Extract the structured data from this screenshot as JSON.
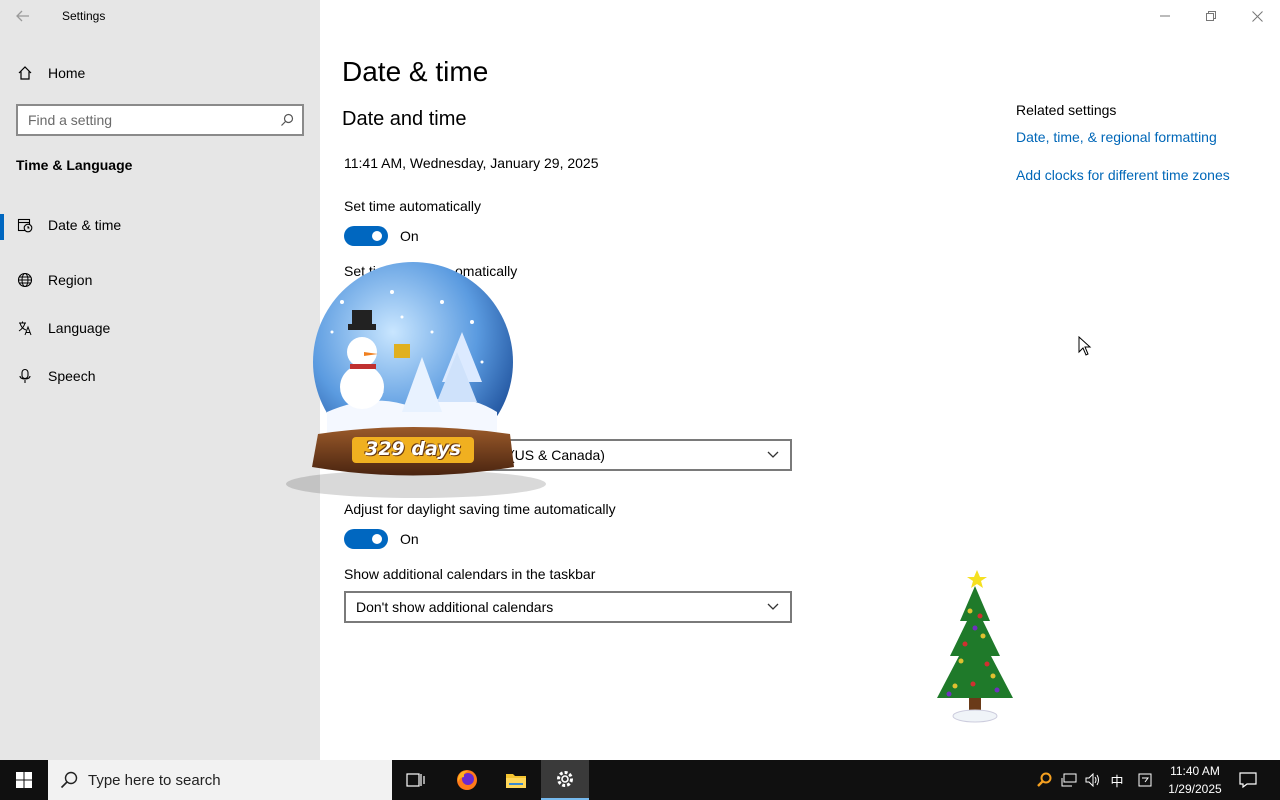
{
  "window": {
    "app_title": "Settings"
  },
  "sidebar": {
    "home_label": "Home",
    "search_placeholder": "Find a setting",
    "section_title": "Time & Language",
    "items": [
      {
        "label": "Date & time",
        "icon": "date-time-icon",
        "active": true
      },
      {
        "label": "Region",
        "icon": "globe-icon",
        "active": false
      },
      {
        "label": "Language",
        "icon": "language-icon",
        "active": false
      },
      {
        "label": "Speech",
        "icon": "microphone-icon",
        "active": false
      }
    ]
  },
  "main": {
    "page_title": "Date & time",
    "sub_title": "Date and time",
    "current_time": "11:41 AM, Wednesday, January 29, 2025",
    "set_time_auto_label": "Set time automatically",
    "set_time_auto_state": "On",
    "set_timezone_auto_label_visible_start": "Set ti",
    "set_timezone_auto_label_visible_end": "omatically",
    "timezone_value_visible": "(US & Canada)",
    "dst_label": "Adjust for daylight saving time automatically",
    "dst_state": "On",
    "calendars_label": "Show additional calendars in the taskbar",
    "calendars_value": "Don't show additional calendars"
  },
  "related": {
    "heading": "Related settings",
    "links": [
      "Date, time, & regional formatting",
      "Add clocks for different time zones"
    ]
  },
  "overlay": {
    "countdown_text": "329 days"
  },
  "taskbar": {
    "search_placeholder": "Type here to search",
    "ime_label": "中",
    "clock_time": "11:40 AM",
    "clock_date": "1/29/2025"
  },
  "colors": {
    "accent": "#0067c0",
    "link": "#0067b8",
    "sidebar_bg": "#e6e6e6",
    "taskbar_bg": "#101010"
  }
}
